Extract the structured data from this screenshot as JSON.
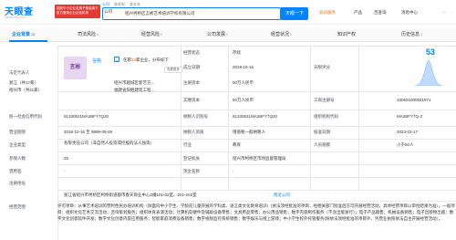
{
  "header": {
    "logo": "天眼查",
    "logo_sub": "TianYanCha.com",
    "banner_line1": "国家中小企业发展子基金旗下",
    "banner_line2": "官方备案企业征信机构",
    "search_tabs": [
      "公司",
      "查老板",
      "查关系"
    ],
    "search_type": "公司",
    "search_value": "绍兴柯桥区言彬艺术培训学校有限公司",
    "search_button": "天眼一下",
    "nav_member": "会员服务",
    "nav_product": "产品",
    "nav_baiqian": "百查询",
    "nav_message": "消息中心",
    "nav_more": "···"
  },
  "tabs": [
    {
      "label": "企业背景",
      "count": "28"
    },
    {
      "label": "司法风险",
      "count": "0"
    },
    {
      "label": "经营风险",
      "count": "0"
    },
    {
      "label": "公司发展",
      "count": "0"
    },
    {
      "label": "经营状况",
      "count": "0"
    },
    {
      "label": "知识产权",
      "count": ""
    },
    {
      "label": "历史信息",
      "count": "1"
    }
  ],
  "legal": {
    "row_label": "法定代表人",
    "avatar_text": "言彬",
    "name": "言彬",
    "badge": "人",
    "tenure_prefix": "任职",
    "tenure_count": "33",
    "tenure_suffix": "家企业，分布如下",
    "region1_label": "浙江",
    "region1_count": "（共17家）",
    "region2_label": "绍兴市",
    "region2_count": "（共11家）",
    "sub1": "绍兴市越城区新艺方...",
    "sub2": "福建省阳胜建筑工程...",
    "more_button": "查看更多"
  },
  "rows": {
    "status_label": "经营状态",
    "status_value": "存续",
    "founded_label": "成立日期",
    "founded_value": "2018-10-16",
    "registered_label": "注册资本",
    "registered_value": "50万人民币",
    "paid_label": "实缴资本",
    "paid_value": "50万人民币",
    "reg_no_label": "工商注册号",
    "reg_no_value": "330621000551971",
    "credit_label": "统一社会信用代码",
    "credit_value": "91330621MA2BFY7Q20",
    "taxpayer_label": "纳税人识别号",
    "taxpayer_value": "91330621MA2BFY7Q20",
    "org_label": "组织机构代码",
    "org_value": "MA2BFY7Q-2",
    "period_label": "营业期限",
    "period_value": "2018-10-16 至 9999-09-09",
    "taxtype_label": "纳税人资质",
    "taxtype_value": "增值税一般纳税人",
    "approve_label": "核准日期",
    "approve_value": "2023-03-17",
    "type_label": "企业类型",
    "type_value": "有限责任公司（非自然人投资或控股的法人独资）",
    "industry_label": "行业",
    "industry_value": "教育",
    "staff_label": "人员规模",
    "staff_value": "小于50人",
    "insured_label": "参保人数",
    "insured_value": "25",
    "authority_label": "登记机关",
    "authority_value": "绍兴市柯桥区市场监督管理局",
    "former_label": "曾用名",
    "former_value": "-",
    "english_label": "英文名称",
    "english_value": "-",
    "address_label": "注册地址",
    "address_value": "浙江省绍兴市柯桥区柯桥街道都市春天商业中心2幢101-02室、201-202室",
    "address_link": "附近公司",
    "scope_label": "经营范围",
    "scope_value": "许可项目：从事艺术培训的营利性民办培训机构（除面向中小学生、学龄前儿童开展的学科类、语言类文化教育培训）(依法须经批准的项目，经相关部门批准后方可开展经营活动，具体经营项目以审批结果为准）。一般项目：组织文化艺术交流活动；咨询策划服务；组织体育表演活动；计算机软硬件及辅助设备零售；文具用品零售；办公用品销售；数字内容制作服务（不含出版发行）；电子产品销售；机械设备销售；电子出版物出版；数字文化创意软件开发；数字文化创意内容应用服务；智能家庭消费设备销售；数字视频监控系统销售；数字娱乐与线上游戏；中小学生校外托管服务(除依法须经批准的项目外，凭营业执照依法自主开展经营活动）。"
  },
  "score": {
    "title": "天眼评分",
    "value": "53"
  }
}
